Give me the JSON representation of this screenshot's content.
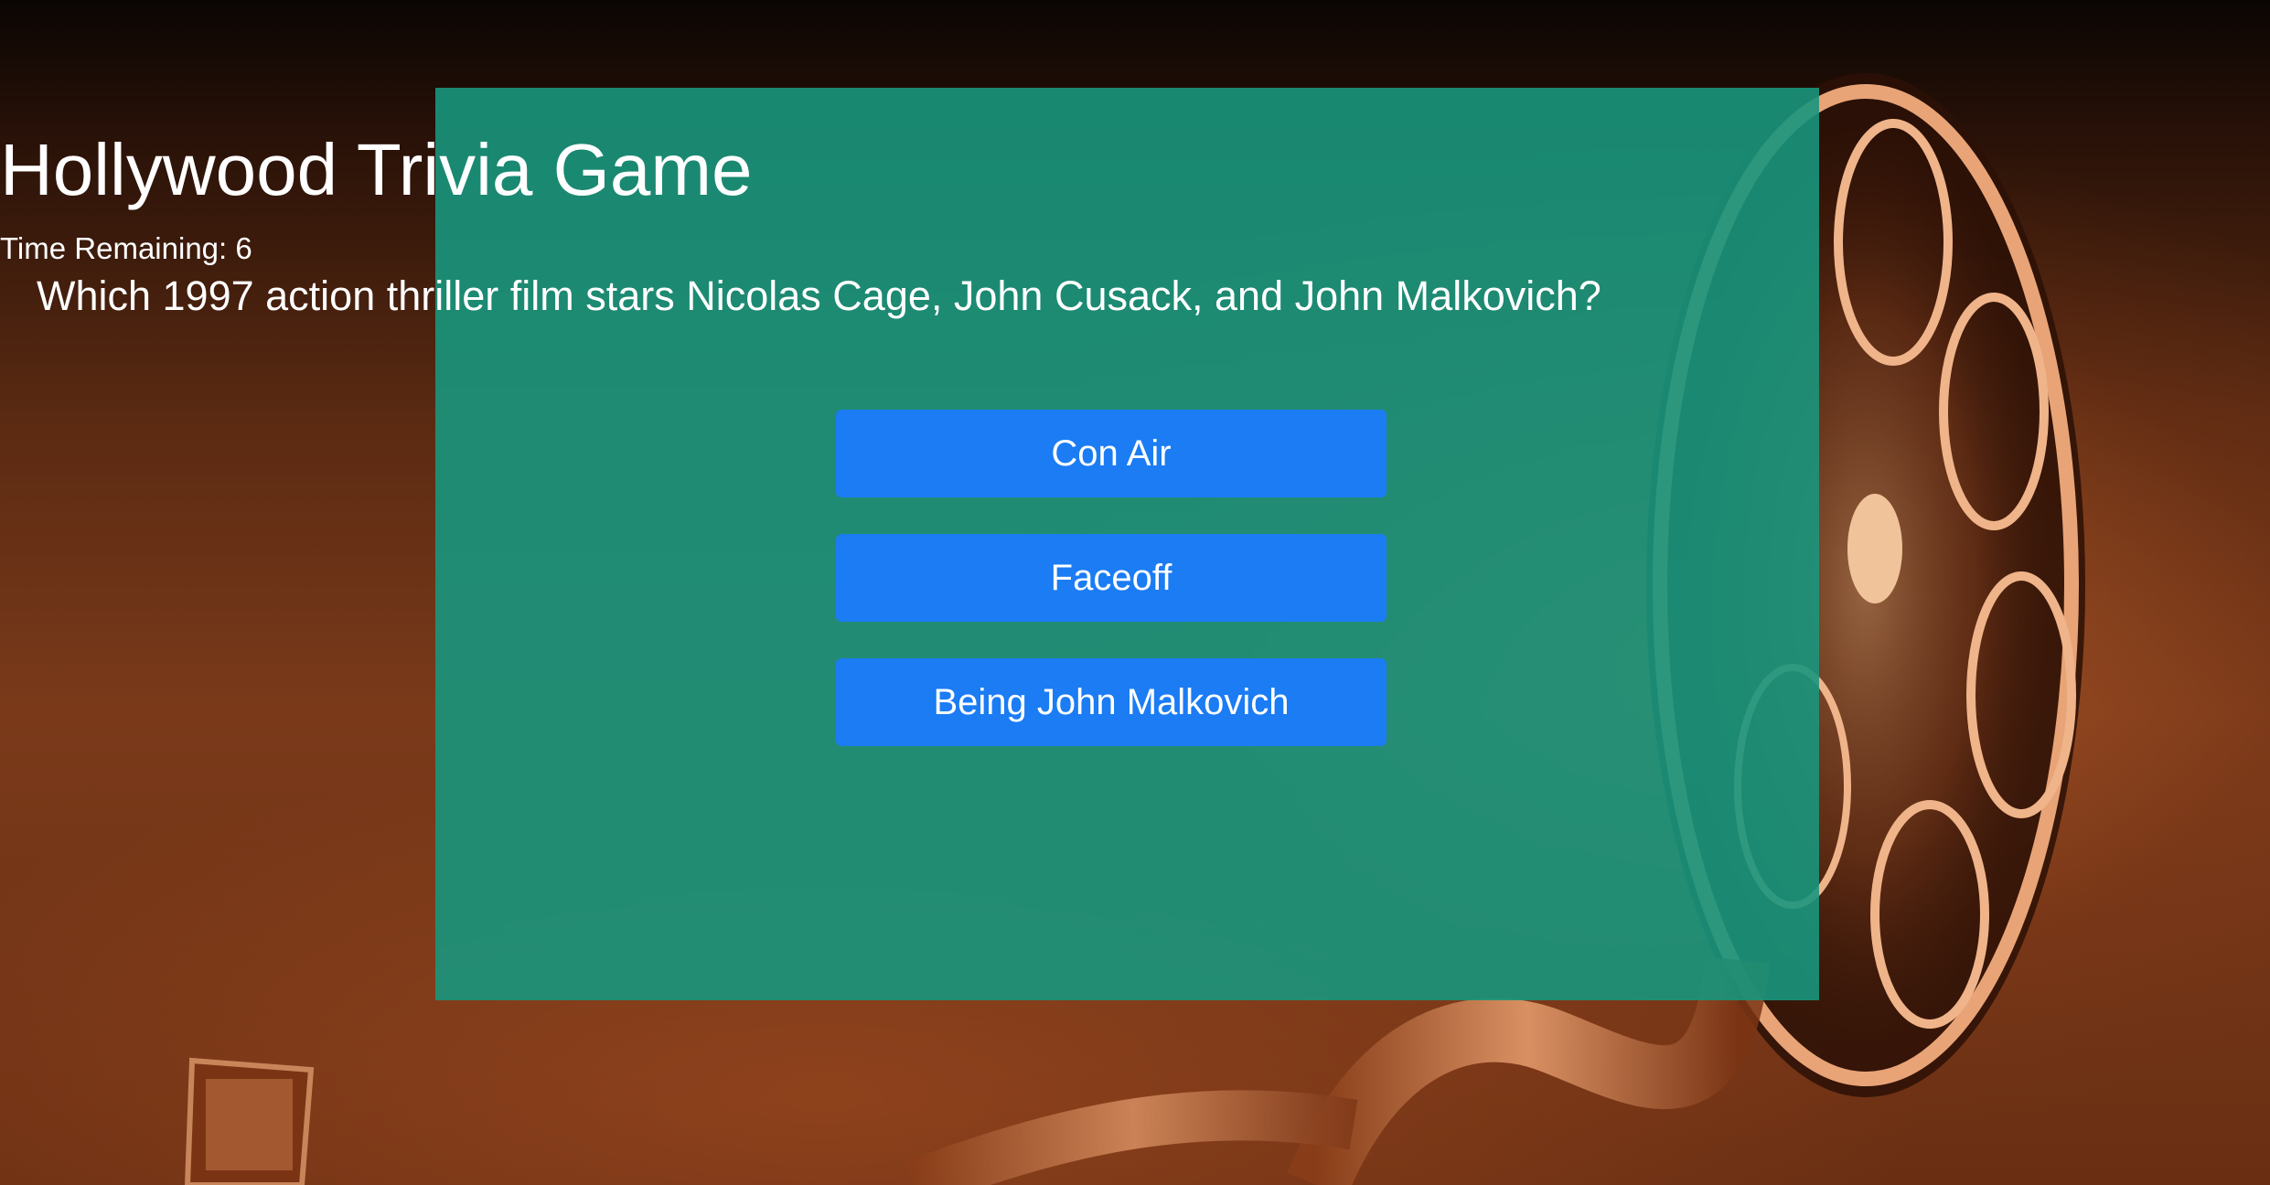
{
  "game": {
    "title": "Hollywood Trivia Game",
    "timer_label": "Time Remaining: 6",
    "question": "Which 1997 action thriller film stars Nicolas Cage, John Cusack, and John Malkovich?",
    "answers": [
      {
        "label": "Con Air"
      },
      {
        "label": "Faceoff"
      },
      {
        "label": "Being John Malkovich"
      }
    ]
  },
  "colors": {
    "panel": "#18967d",
    "button": "#1b7cf4",
    "text": "#ffffff",
    "background": "#6a2f13"
  },
  "background_image": "film-reel-icon"
}
